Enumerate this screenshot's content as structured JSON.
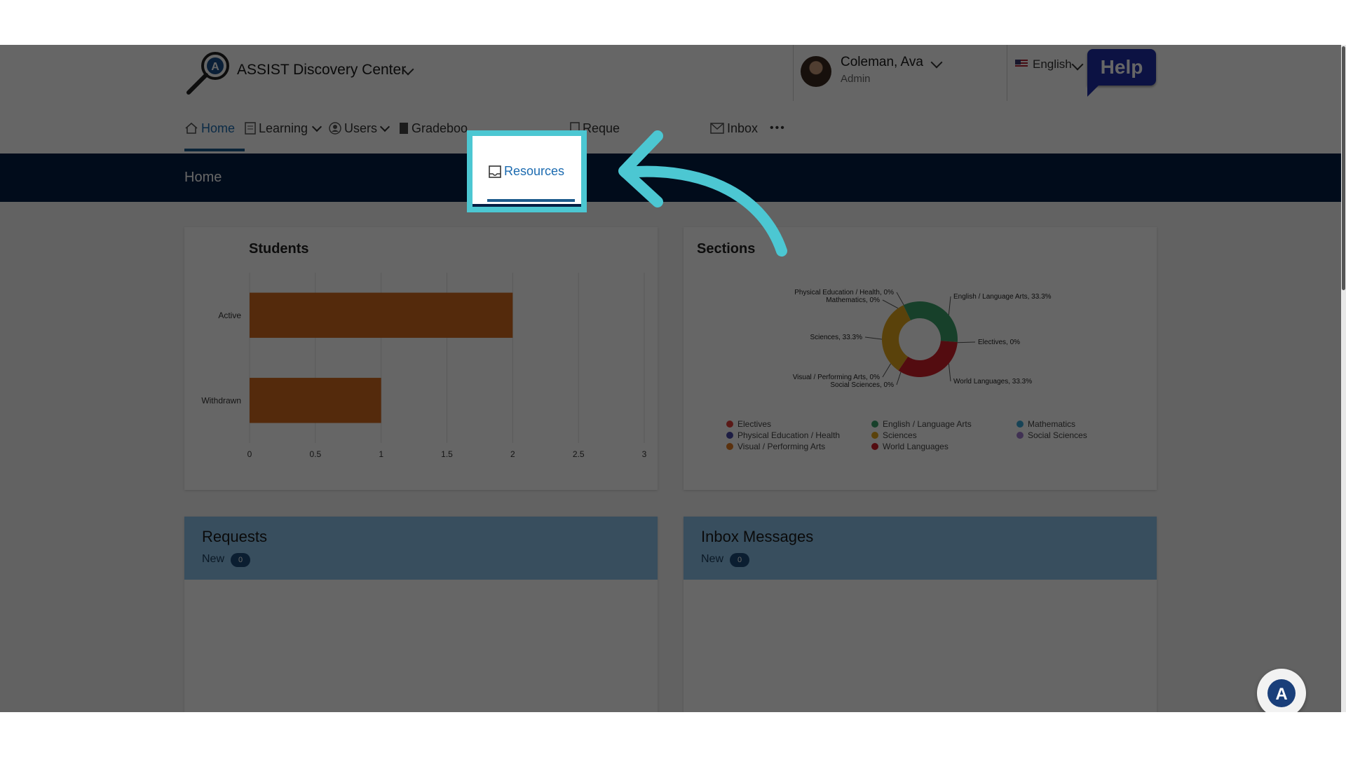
{
  "header": {
    "app_title": "ASSIST Discovery Center",
    "user_name": "Coleman, Ava",
    "user_role": "Admin",
    "language": "English",
    "help_label": "Help"
  },
  "nav": {
    "home": "Home",
    "learning": "Learning",
    "users": "Users",
    "gradebook": "Gradeboo",
    "resources": "Resources",
    "requests": "Reque",
    "inbox": "Inbox",
    "more": "•••"
  },
  "breadcrumb": "Home",
  "students": {
    "title": "Students",
    "chart_data": {
      "type": "bar",
      "orientation": "horizontal",
      "categories": [
        "Active",
        "Withdrawn"
      ],
      "values": [
        2,
        1
      ],
      "xlim": [
        0,
        3
      ],
      "x_ticks": [
        "0",
        "0.5",
        "1",
        "1.5",
        "2",
        "2.5",
        "3"
      ],
      "grid": true,
      "color": "#d26a1e"
    }
  },
  "sections": {
    "title": "Sections",
    "chart_data": {
      "type": "pie",
      "donut": true,
      "slices": [
        {
          "label": "English / Language Arts, 33.3%",
          "name": "English / Language Arts",
          "value": 33.3,
          "color": "#3aa06a"
        },
        {
          "label": "World Languages, 33.3%",
          "name": "World Languages",
          "value": 33.3,
          "color": "#d0202a"
        },
        {
          "label": "Sciences, 33.3%",
          "name": "Sciences",
          "value": 33.3,
          "color": "#e0a61c"
        },
        {
          "label": "Electives, 0%",
          "name": "Electives",
          "value": 0,
          "color": "#e0403a"
        },
        {
          "label": "Visual / Performing Arts, 0%",
          "name": "Visual / Performing Arts",
          "value": 0,
          "color": "#e07a24"
        },
        {
          "label": "Social Sciences, 0%",
          "name": "Social Sciences",
          "value": 0,
          "color": "#a07ad0"
        },
        {
          "label": "Physical Education / Health, 0%",
          "name": "Physical Education / Health",
          "value": 0,
          "color": "#4a4aa8"
        },
        {
          "label": "Mathematics, 0%",
          "name": "Mathematics",
          "value": 0,
          "color": "#3aa8d8"
        }
      ],
      "legend": [
        {
          "name": "Electives",
          "color": "#e0403a"
        },
        {
          "name": "English / Language Arts",
          "color": "#3aa06a"
        },
        {
          "name": "Mathematics",
          "color": "#3aa8d8"
        },
        {
          "name": "Physical Education / Health",
          "color": "#4a4aa8"
        },
        {
          "name": "Sciences",
          "color": "#e0a61c"
        },
        {
          "name": "Social Sciences",
          "color": "#a07ad0"
        },
        {
          "name": "Visual / Performing Arts",
          "color": "#e07a24"
        },
        {
          "name": "World Languages",
          "color": "#d0202a"
        }
      ],
      "legend_position": "bottom"
    }
  },
  "requests": {
    "title": "Requests",
    "new_label": "New",
    "count": "0"
  },
  "inbox_messages": {
    "title": "Inbox Messages",
    "new_label": "New",
    "count": "0"
  },
  "icons": [
    "logo-icon",
    "home-icon",
    "learning-icon",
    "users-icon",
    "gradebook-icon",
    "resources-icon",
    "requests-icon",
    "inbox-icon",
    "chevron-down-icon",
    "flag-icon",
    "assist-fab-icon",
    "tutorial-arrow-icon"
  ],
  "colors": {
    "accent": "#1c5a8c",
    "nav_bar": "#041f44",
    "highlight": "#4cc7d2",
    "help": "#1f2fa8",
    "panel_head": "#8cc2ea"
  }
}
